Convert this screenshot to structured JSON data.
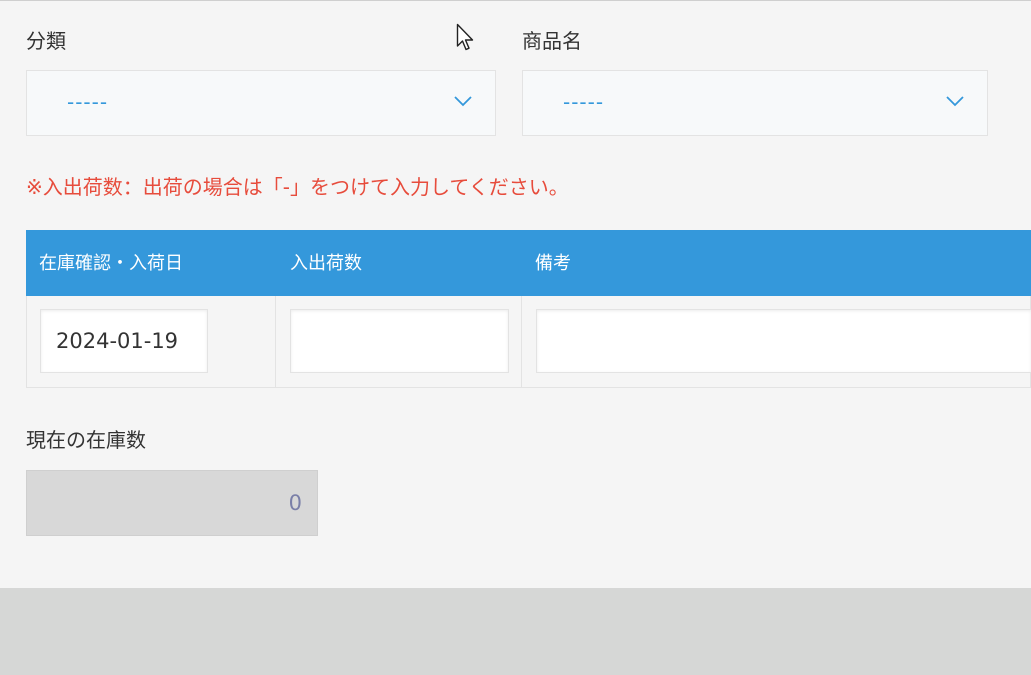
{
  "fields": {
    "category": {
      "label": "分類",
      "value": "-----"
    },
    "product_name": {
      "label": "商品名",
      "value": "-----"
    }
  },
  "notice": "※入出荷数：出荷の場合は「-」をつけて入力してください。",
  "table": {
    "headers": [
      "在庫確認・入荷日",
      "入出荷数",
      "備考"
    ],
    "row": {
      "date": "2024-01-19",
      "quantity": "",
      "remarks": ""
    }
  },
  "stock": {
    "label": "現在の在庫数",
    "value": "0"
  },
  "colors": {
    "header_bg": "#3498db",
    "notice_text": "#e74c3c",
    "select_value": "#3498db"
  },
  "icons": [
    "chevron-down-icon",
    "mouse-cursor-icon"
  ]
}
